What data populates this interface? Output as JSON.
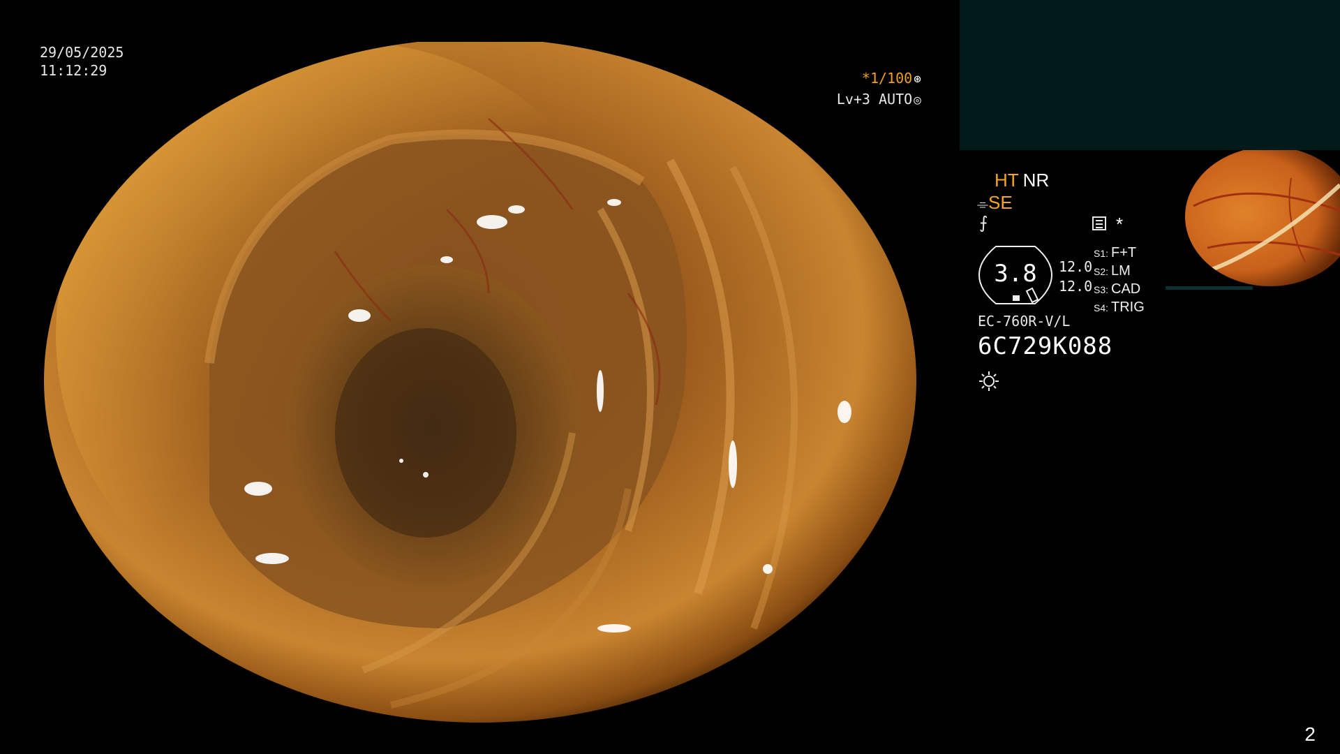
{
  "overlay": {
    "date": "29/05/2025",
    "time": "11:12:29",
    "shutter_speed": "*1/100",
    "level_mode": "Lv+3 AUTO"
  },
  "status": {
    "ht_label": "HT",
    "nr_label": "NR",
    "se_label": "SE",
    "gauge_value": "3.8",
    "gauge_side_top": "12.0",
    "gauge_side_bottom": "12.0",
    "switches": [
      {
        "key": "S1:",
        "value": "F+T"
      },
      {
        "key": "S2:",
        "value": "LM"
      },
      {
        "key": "S3:",
        "value": "CAD"
      },
      {
        "key": "S4:",
        "value": "TRIG"
      }
    ],
    "scope_model": "EC-760R-V/L",
    "serial_number": "6C729K088",
    "star": "*"
  },
  "page_number": "2",
  "colors": {
    "accent_orange": "#f5a623",
    "panel_teal": "#031a1a",
    "background": "#000000"
  }
}
